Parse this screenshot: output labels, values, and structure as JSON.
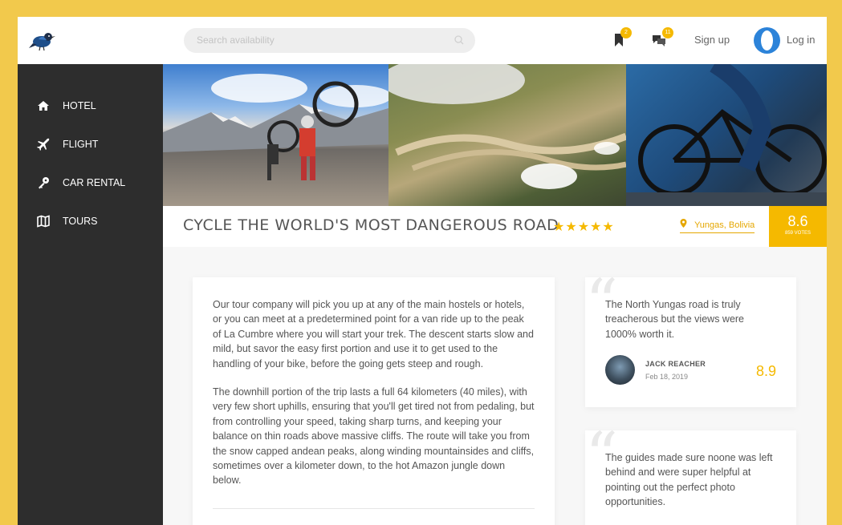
{
  "header": {
    "search_placeholder": "Search availability",
    "bookmark_badge": "2",
    "messages_badge": "11",
    "signup_label": "Sign up",
    "login_label": "Log in",
    "accent": "#f5b900",
    "avatar_color": "#2c83d9"
  },
  "sidebar": {
    "items": [
      {
        "label": "HOTEL",
        "icon": "home-icon"
      },
      {
        "label": "FLIGHT",
        "icon": "plane-icon"
      },
      {
        "label": "CAR RENTAL",
        "icon": "key-icon"
      },
      {
        "label": "TOURS",
        "icon": "map-icon"
      }
    ]
  },
  "tour": {
    "title": "CYCLE THE WORLD'S MOST DANGEROUS ROAD",
    "stars": "★★★★★",
    "rating_stars": 5,
    "location": "Yungas, Bolivia",
    "score": "8.6",
    "votes": "859 VOTES"
  },
  "content": {
    "paragraph1": "Our tour company will pick you up at any of the main hostels or hotels, or you can meet at a predetermined point for a van ride up to the peak of La Cumbre where you will start your trek. The descent starts slow and mild, but savor the easy first portion and use it to get used to the handling of your bike, before the going gets steep and rough.",
    "paragraph2": "The downhill portion of the trip lasts a full 64 kilometers (40 miles), with very few short uphills, ensuring that you'll get tired not from pedaling, but from controlling your speed, taking sharp turns, and keeping your balance on thin roads above massive cliffs. The route will take you from the snow capped andean peaks, along winding mountainsides and cliffs, sometimes over a kilometer down, to the hot Amazon jungle down below."
  },
  "reviews": [
    {
      "text": "The North Yungas road is truly treacherous but the views were 1000% worth it.",
      "name": "JACK REACHER",
      "date": "Feb 18, 2019",
      "score": "8.9"
    },
    {
      "text": "The guides made sure noone was left behind and were super helpful at pointing out the perfect photo opportunities."
    }
  ]
}
